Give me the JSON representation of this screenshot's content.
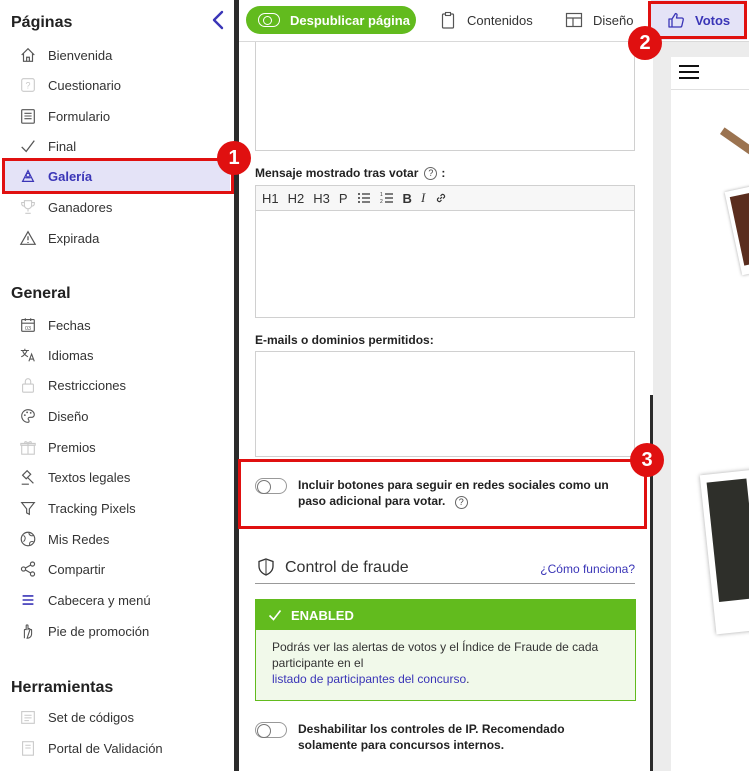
{
  "sidebar": {
    "sections": [
      {
        "title": "Páginas",
        "items": [
          {
            "label": "Bienvenida",
            "icon": "home-icon"
          },
          {
            "label": "Cuestionario",
            "icon": "question-icon"
          },
          {
            "label": "Formulario",
            "icon": "form-icon"
          },
          {
            "label": "Final",
            "icon": "check-icon"
          },
          {
            "label": "Galería",
            "icon": "gallery-icon",
            "active": true
          },
          {
            "label": "Ganadores",
            "icon": "trophy-icon"
          },
          {
            "label": "Expirada",
            "icon": "warning-icon"
          }
        ]
      },
      {
        "title": "General",
        "items": [
          {
            "label": "Fechas",
            "icon": "calendar-icon"
          },
          {
            "label": "Idiomas",
            "icon": "translate-icon"
          },
          {
            "label": "Restricciones",
            "icon": "lock-icon"
          },
          {
            "label": "Diseño",
            "icon": "palette-icon"
          },
          {
            "label": "Premios",
            "icon": "gift-icon"
          },
          {
            "label": "Textos legales",
            "icon": "gavel-icon"
          },
          {
            "label": "Tracking Pixels",
            "icon": "filter-icon"
          },
          {
            "label": "Mis Redes",
            "icon": "globe-icon"
          },
          {
            "label": "Compartir",
            "icon": "share-icon"
          },
          {
            "label": "Cabecera y menú",
            "icon": "menu-icon"
          },
          {
            "label": "Pie de promoción",
            "icon": "hand-icon"
          }
        ]
      },
      {
        "title": "Herramientas",
        "items": [
          {
            "label": "Set de códigos",
            "icon": "code-icon"
          },
          {
            "label": "Portal de Validación",
            "icon": "portal-icon"
          }
        ]
      }
    ]
  },
  "toolbar": {
    "unpublish_label": "Despublicar página",
    "tabs": {
      "contents": "Contenidos",
      "design": "Diseño",
      "votes": "Votos"
    }
  },
  "editor": {
    "message_label": "Mensaje mostrado tras votar",
    "message_label_suffix": ":",
    "rte_buttons": [
      "H1",
      "H2",
      "H3",
      "P"
    ],
    "emails_label": "E-mails o dominios permitidos:",
    "social_toggle_label": "Incluir botones para seguir en redes sociales como un paso adicional para votar.",
    "fraud": {
      "title": "Control de fraude",
      "how_link": "¿Cómo funciona?",
      "enabled_label": "ENABLED",
      "enabled_text": "Podrás ver las alertas de votos y el Índice de Fraude de cada participante en el",
      "enabled_link": "listado de participantes del concurso",
      "enabled_period": ".",
      "ip_toggle_label": "Deshabilitar los controles de IP. Recomendado solamente para concursos internos."
    }
  },
  "callouts": [
    "1",
    "2",
    "3"
  ],
  "colors": {
    "accent": "#3a35b7",
    "active_bg": "#e4e3f7",
    "green": "#62bb1e",
    "callout_red": "#e01010"
  }
}
